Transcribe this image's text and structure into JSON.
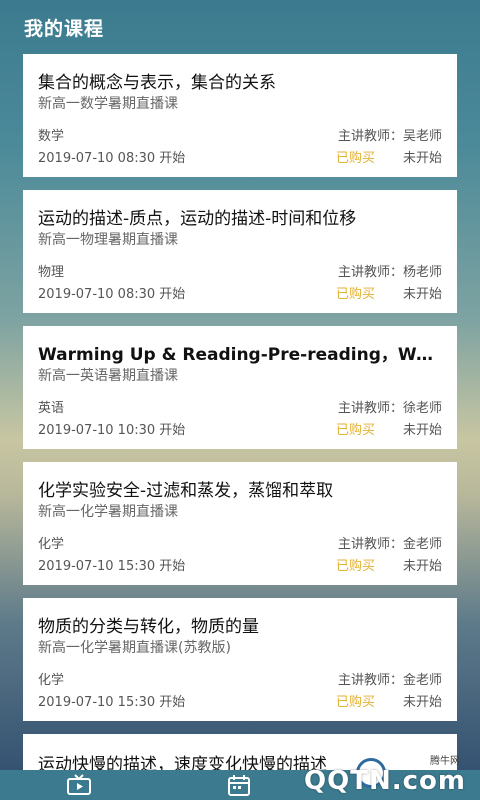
{
  "header": {
    "title": "我的课程"
  },
  "courses": [
    {
      "title": "集合的概念与表示，集合的关系",
      "subtitle": "新高一数学暑期直播课",
      "subject": "数学",
      "teacher": "主讲教师：吴老师",
      "time": "2019-07-10 08:30 开始",
      "purchase": "已购买",
      "status": "未开始"
    },
    {
      "title": "运动的描述-质点，运动的描述-时间和位移",
      "subtitle": "新高一物理暑期直播课",
      "subject": "物理",
      "teacher": "主讲教师：杨老师",
      "time": "2019-07-10 08:30 开始",
      "purchase": "已购买",
      "status": "未开始"
    },
    {
      "title": "Warming Up & Reading-Pre-reading，Warmin...",
      "subtitle": "新高一英语暑期直播课",
      "subject": "英语",
      "teacher": "主讲教师：徐老师",
      "time": "2019-07-10 10:30 开始",
      "purchase": "已购买",
      "status": "未开始"
    },
    {
      "title": "化学实验安全-过滤和蒸发，蒸馏和萃取",
      "subtitle": "新高一化学暑期直播课",
      "subject": "化学",
      "teacher": "主讲教师：金老师",
      "time": "2019-07-10 15:30 开始",
      "purchase": "已购买",
      "status": "未开始"
    },
    {
      "title": "物质的分类与转化，物质的量",
      "subtitle": "新高一化学暑期直播课(苏教版)",
      "subject": "化学",
      "teacher": "主讲教师：金老师",
      "time": "2019-07-10 15:30 开始",
      "purchase": "已购买",
      "status": "未开始"
    }
  ],
  "partial_course": {
    "title": "运动快慢的描述，速度变化快慢的描述"
  },
  "tabbar": {
    "icons": [
      "tv-icon",
      "calendar-icon"
    ]
  },
  "watermark": {
    "small": "腾牛网",
    "big": "QQTN.com"
  },
  "colors": {
    "purchase": "#e4b230",
    "header_bg": "#3c7a8f"
  }
}
